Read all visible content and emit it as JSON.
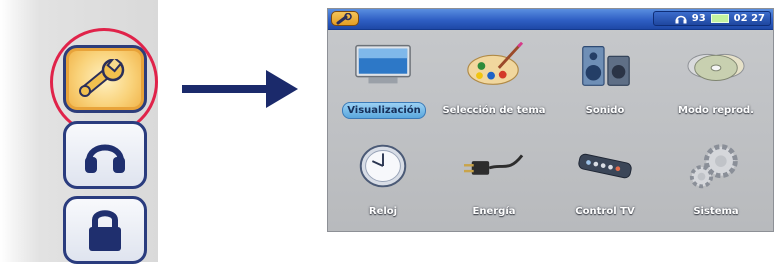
{
  "sidebar": {
    "buttons": [
      {
        "icon": "wrench-icon",
        "selected": true
      },
      {
        "icon": "headphones-icon",
        "selected": false
      },
      {
        "icon": "lock-icon",
        "selected": false
      }
    ],
    "highlight_color": "#e0234a"
  },
  "arrow": {
    "color": "#1b2a6b"
  },
  "device": {
    "topbar": {
      "menu_icon": "wrench-icon",
      "volume": "93",
      "clock": "02 27"
    },
    "items": [
      {
        "label": "Visualización",
        "icon": "monitor-icon"
      },
      {
        "label": "Selección de tema",
        "icon": "palette-icon"
      },
      {
        "label": "Sonido",
        "icon": "speakers-icon"
      },
      {
        "label": "Modo reprod.",
        "icon": "discs-icon"
      },
      {
        "label": "Reloj",
        "icon": "clock-icon"
      },
      {
        "label": "Energía",
        "icon": "power-plug-icon"
      },
      {
        "label": "Control TV",
        "icon": "remote-control-icon"
      },
      {
        "label": "Sistema",
        "icon": "gears-icon"
      }
    ],
    "active_index": 0
  }
}
